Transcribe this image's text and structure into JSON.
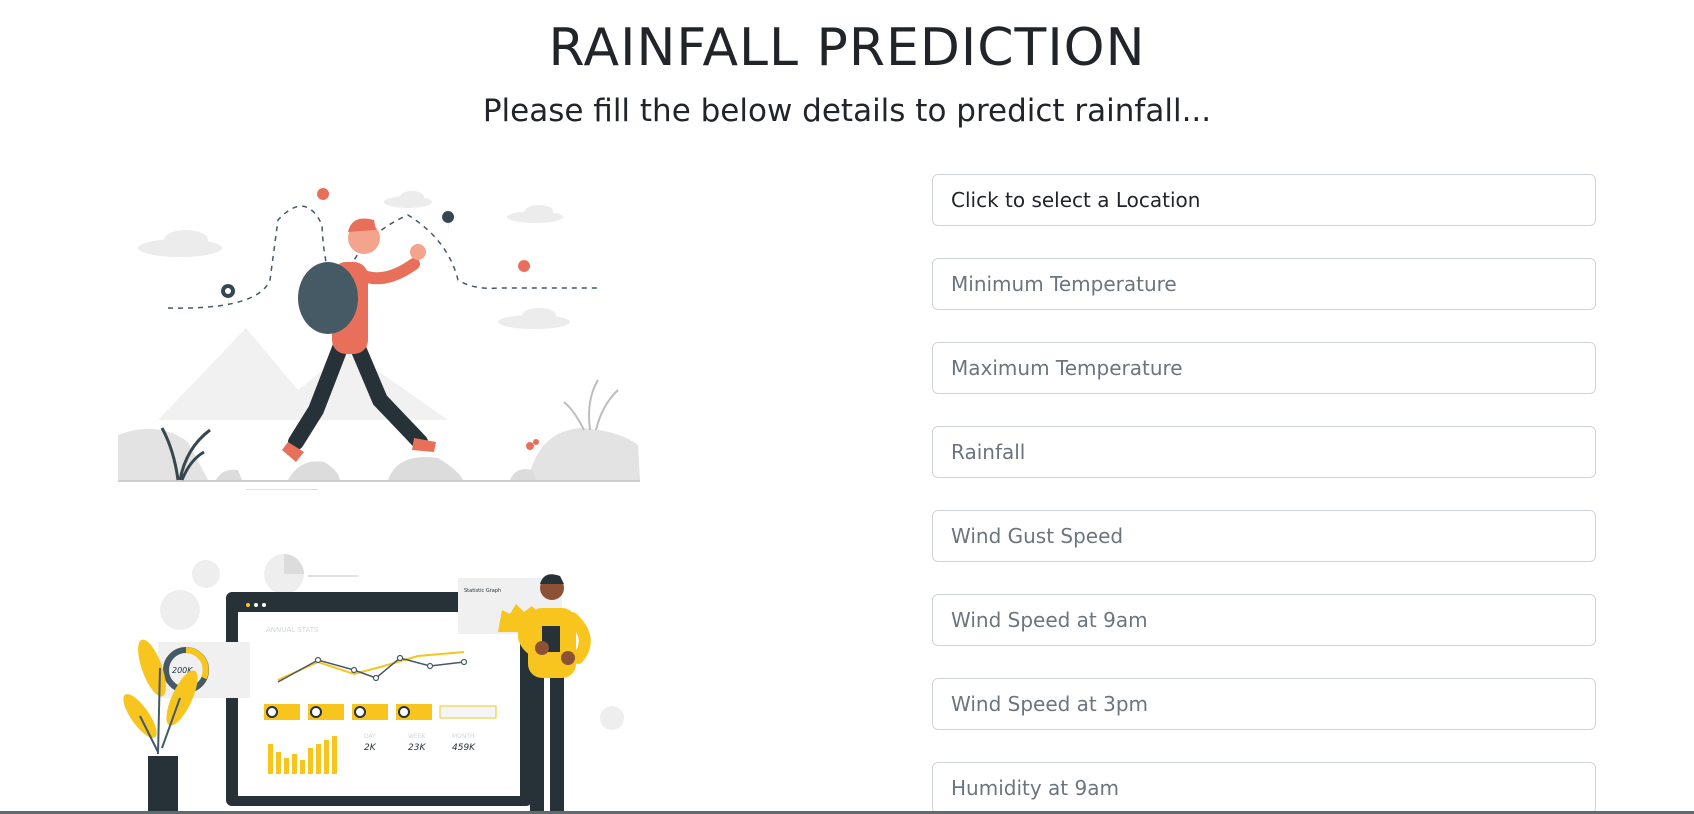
{
  "header": {
    "title": "RAINFALL PREDICTION",
    "subtitle": "Please fill the below details to predict rainfall..."
  },
  "form": {
    "location_select": {
      "label": "Click to select a Location"
    },
    "fields": [
      {
        "key": "min_temp",
        "placeholder": "Minimum Temperature"
      },
      {
        "key": "max_temp",
        "placeholder": "Maximum Temperature"
      },
      {
        "key": "rainfall",
        "placeholder": "Rainfall"
      },
      {
        "key": "wind_gust_speed",
        "placeholder": "Wind Gust Speed"
      },
      {
        "key": "wind_speed_9am",
        "placeholder": "Wind Speed at 9am"
      },
      {
        "key": "wind_speed_3pm",
        "placeholder": "Wind Speed at 3pm"
      },
      {
        "key": "humidity_9am",
        "placeholder": "Humidity at 9am"
      }
    ]
  },
  "illustrations": {
    "dashboard": {
      "chart_title": "ANNUAL STATS",
      "donut_value": "200K",
      "card_title": "Statistic Graph",
      "stats": [
        {
          "label": "DAY",
          "value": "2K"
        },
        {
          "label": "WEEK",
          "value": "23K"
        },
        {
          "label": "MONTH",
          "value": "459K"
        }
      ]
    }
  },
  "colors": {
    "accent_coral": "#e8705a",
    "accent_yellow": "#f7c51e",
    "dark_slate": "#263238",
    "grey_shape": "#e6e6e6"
  }
}
